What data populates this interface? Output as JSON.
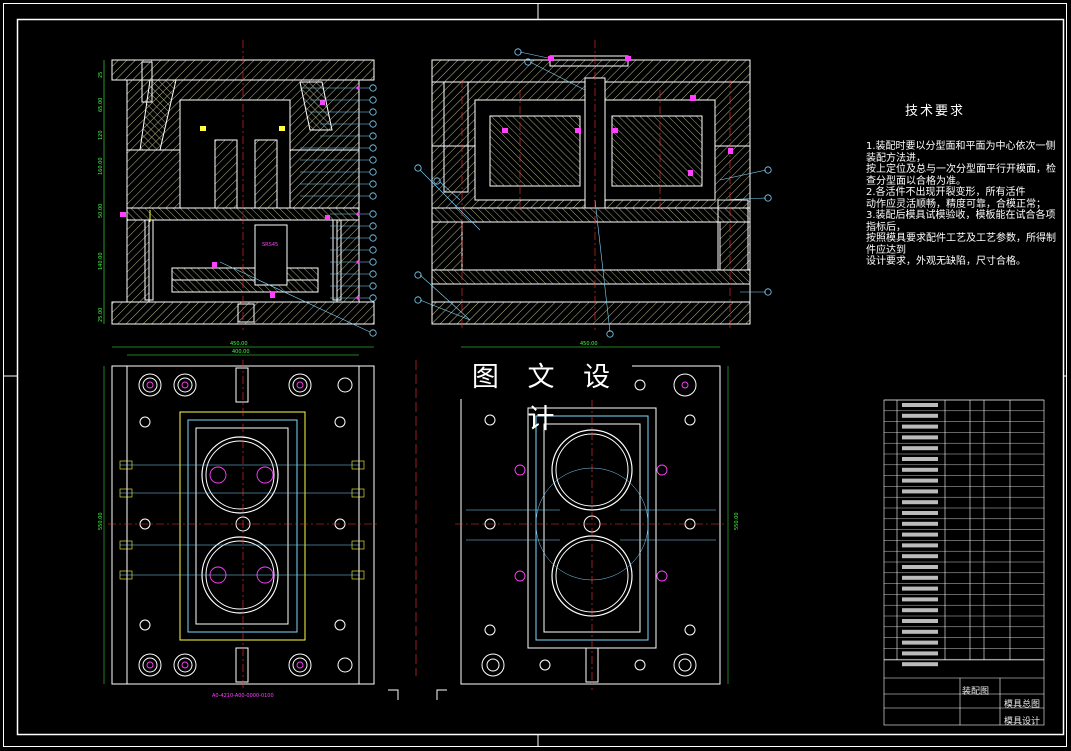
{
  "watermark": "图 文 设 计",
  "technical_requirements": {
    "title": "技术要求",
    "lines": [
      "1.装配时要以分型面和平面为中心依次一侧装配方法进，",
      "按上定位及总与一次分型面平行开模面，检查分型面以合格为准。",
      "2.各活件不出现开裂变形，所有活件",
      "动作应灵活顺畅，精度可靠，合模正常；",
      "3.装配后模具试模验收，模板能在试合各项指标后，",
      "按照模具要求配件工艺及工艺参数，所得制件应达到",
      "设计要求，外观无缺陷，尺寸合格。"
    ]
  },
  "title_block": {
    "drawing_name": "装配图",
    "drawing_label": "模具总图",
    "project_code": "模具设计"
  },
  "part_number_label": "A0-4210-A00-0000-0100",
  "colors": {
    "background": "#000000",
    "border": "#ffffff",
    "hatch": "#d9d9a0",
    "outline": "#ffffff",
    "leader": "#7fd8ff",
    "magenta": "#ff40ff",
    "green": "#40ff40",
    "yellow": "#ffff40",
    "red_center": "#ff3030"
  }
}
